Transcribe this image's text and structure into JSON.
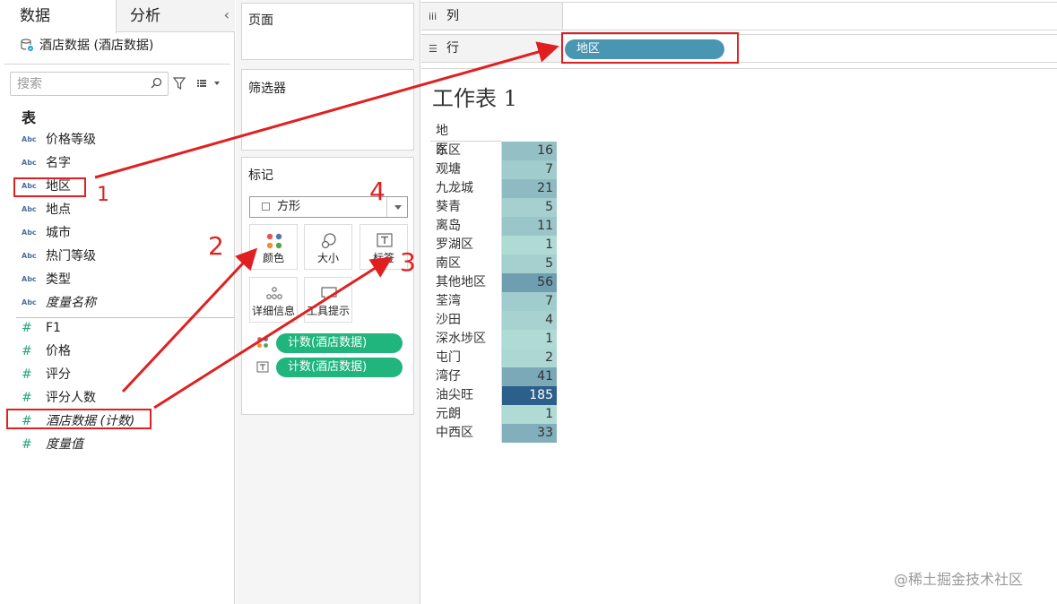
{
  "left_pane": {
    "tabs": [
      {
        "label": "数据"
      },
      {
        "label": "分析"
      }
    ],
    "collapse_glyph": "‹",
    "datasource": "酒店数据 (酒店数据)",
    "search_placeholder": "搜索",
    "section_title": "表",
    "abc_badge": "Abc",
    "hash_badge": "#",
    "dimensions": [
      {
        "label": "价格等级"
      },
      {
        "label": "名字"
      },
      {
        "label": "地区"
      },
      {
        "label": "地点"
      },
      {
        "label": "城市"
      },
      {
        "label": "热门等级"
      },
      {
        "label": "类型"
      },
      {
        "label": "度量名称"
      }
    ],
    "measures": [
      {
        "label": "F1"
      },
      {
        "label": "价格"
      },
      {
        "label": "评分"
      },
      {
        "label": "评分人数"
      },
      {
        "label": "酒店数据 (计数)"
      },
      {
        "label": "度量值"
      }
    ]
  },
  "cards": {
    "pages_title": "页面",
    "filters_title": "筛选器",
    "marks_title": "标记",
    "mark_type": "方形",
    "buttons": [
      {
        "label": "颜色",
        "icon": "color-icon"
      },
      {
        "label": "大小",
        "icon": "size-icon"
      },
      {
        "label": "标签",
        "icon": "label-icon"
      },
      {
        "label": "详细信息",
        "icon": "detail-icon"
      },
      {
        "label": "工具提示",
        "icon": "tooltip-icon"
      }
    ],
    "pills": [
      {
        "label": "计数(酒店数据)",
        "encoding": "color"
      },
      {
        "label": "计数(酒店数据)",
        "encoding": "label"
      }
    ]
  },
  "shelves": {
    "columns_label": "列",
    "rows_label": "行",
    "rows_pill": "地区"
  },
  "view": {
    "sheet_title": "工作表 1",
    "table_header": "地区",
    "rows": [
      {
        "label": "东区",
        "value": "16"
      },
      {
        "label": "观塘",
        "value": "7"
      },
      {
        "label": "九龙城",
        "value": "21"
      },
      {
        "label": "葵青",
        "value": "5"
      },
      {
        "label": "离岛",
        "value": "11"
      },
      {
        "label": "罗湖区",
        "value": "1"
      },
      {
        "label": "南区",
        "value": "5"
      },
      {
        "label": "其他地区",
        "value": "56"
      },
      {
        "label": "荃湾",
        "value": "7"
      },
      {
        "label": "沙田",
        "value": "4"
      },
      {
        "label": "深水埗区",
        "value": "1"
      },
      {
        "label": "屯门",
        "value": "2"
      },
      {
        "label": "湾仔",
        "value": "41"
      },
      {
        "label": "油尖旺",
        "value": "185"
      },
      {
        "label": "元朗",
        "value": "1"
      },
      {
        "label": "中西区",
        "value": "33"
      }
    ]
  },
  "annotations": {
    "step_1": "1",
    "step_2": "2",
    "step_3": "3",
    "step_4": "4"
  },
  "watermark": "@稀土掘金技术社区",
  "colors": {
    "dimension_badge": "#4a6f9e",
    "measure_badge": "#25a67b",
    "pill_green": "#1fb57d",
    "pill_blue": "#4996b2",
    "annotation_red": "#e02020",
    "heat_low": "#b8e2da",
    "heat_high": "#2c5f8a"
  }
}
